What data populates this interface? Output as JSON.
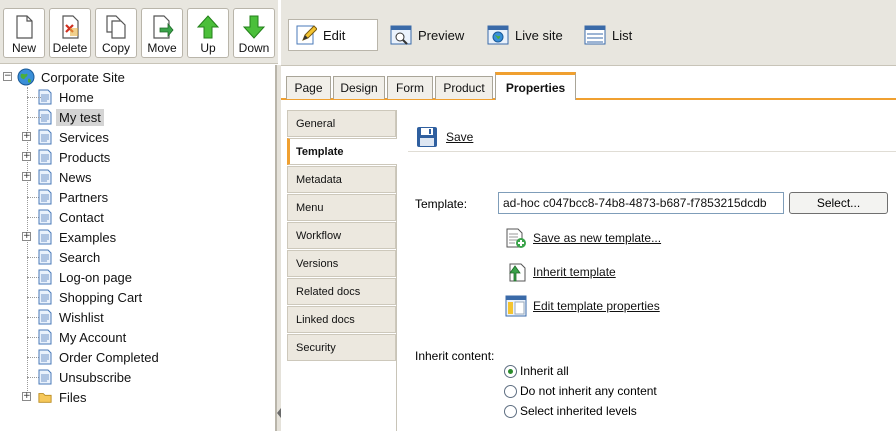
{
  "toolbar": {
    "buttons": [
      {
        "label": "New",
        "icon": "new-page-icon"
      },
      {
        "label": "Delete",
        "icon": "delete-page-icon"
      },
      {
        "label": "Copy",
        "icon": "copy-icon"
      },
      {
        "label": "Move",
        "icon": "move-icon"
      },
      {
        "label": "Up",
        "icon": "arrow-up-icon"
      },
      {
        "label": "Down",
        "icon": "arrow-down-icon"
      }
    ]
  },
  "tree": {
    "root": "Corporate Site",
    "items": [
      {
        "label": "Home",
        "expandable": false
      },
      {
        "label": "My test",
        "expandable": false,
        "selected": true
      },
      {
        "label": "Services",
        "expandable": true
      },
      {
        "label": "Products",
        "expandable": true
      },
      {
        "label": "News",
        "expandable": true
      },
      {
        "label": "Partners",
        "expandable": false
      },
      {
        "label": "Contact",
        "expandable": false
      },
      {
        "label": "Examples",
        "expandable": true
      },
      {
        "label": "Search",
        "expandable": false
      },
      {
        "label": "Log-on page",
        "expandable": false
      },
      {
        "label": "Shopping Cart",
        "expandable": false
      },
      {
        "label": "Wishlist",
        "expandable": false
      },
      {
        "label": "My Account",
        "expandable": false
      },
      {
        "label": "Order Completed",
        "expandable": false
      },
      {
        "label": "Unsubscribe",
        "expandable": false
      },
      {
        "label": "Files",
        "expandable": true
      }
    ]
  },
  "view_modes": {
    "edit": "Edit",
    "preview": "Preview",
    "live_site": "Live site",
    "list": "List"
  },
  "doc_tabs": {
    "page": "Page",
    "design": "Design",
    "form": "Form",
    "product": "Product",
    "properties": "Properties"
  },
  "property_tabs": {
    "general": "General",
    "template": "Template",
    "metadata": "Metadata",
    "menu": "Menu",
    "workflow": "Workflow",
    "versions": "Versions",
    "related_docs": "Related docs",
    "linked_docs": "Linked docs",
    "security": "Security"
  },
  "content": {
    "save_label": "Save",
    "template_label": "Template:",
    "template_value": "ad-hoc c047bcc8-74b8-4873-b687-f7853215dcdb",
    "select_button": "Select...",
    "save_as_new": "Save as new template...",
    "inherit_template": "Inherit template",
    "edit_template_props": "Edit template properties",
    "inherit_content_label": "Inherit content:",
    "radio_inherit_all": "Inherit all",
    "radio_no_inherit": "Do not inherit any content",
    "radio_select_levels": "Select inherited levels",
    "selected_radio": "Inherit all"
  },
  "colors": {
    "accent": "#f0a030",
    "toolbar_bg": "#e8e6df",
    "tab_bg": "#ece8df"
  }
}
